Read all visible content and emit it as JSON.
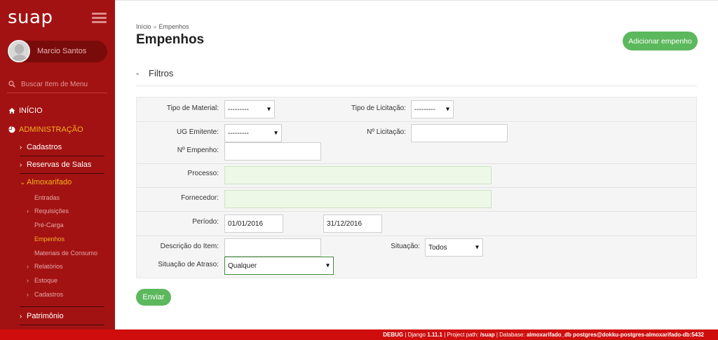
{
  "app": {
    "logo": "suap"
  },
  "user": {
    "name": "Marcio Santos"
  },
  "menu_search": {
    "placeholder": "Buscar Item de Menu"
  },
  "nav": {
    "inicio": "INÍCIO",
    "administracao": "ADMINISTRAÇÃO",
    "cadastros": "Cadastros",
    "reservas": "Reservas de Salas",
    "almoxarifado": "Almoxarifado",
    "sub": {
      "entradas": "Entradas",
      "requisicoes": "Requisições",
      "pre_carga": "Pré-Carga",
      "empenhos": "Empenhos",
      "materiais": "Materiais de Consumo",
      "relatorios": "Relatórios",
      "estoque": "Estoque",
      "cadastros": "Cadastros"
    },
    "patrimonio": "Patrimônio"
  },
  "breadcrumb": {
    "home": "Início",
    "sep": "»",
    "current": "Empenhos"
  },
  "page": {
    "title": "Empenhos",
    "add_button": "Adicionar empenho"
  },
  "filters": {
    "dash": "-",
    "title": "Filtros",
    "tipo_material": {
      "label": "Tipo de Material:",
      "value": "---------"
    },
    "tipo_licitacao": {
      "label": "Tipo de Licitação:",
      "value": "---------"
    },
    "ug_emitente": {
      "label": "UG Emitente:",
      "value": "---------"
    },
    "num_licitacao": {
      "label": "Nº Licitação:",
      "value": ""
    },
    "num_empenho": {
      "label": "Nº Empenho:",
      "value": ""
    },
    "processo": {
      "label": "Processo:",
      "value": ""
    },
    "fornecedor": {
      "label": "Fornecedor:",
      "value": ""
    },
    "periodo": {
      "label": "Período:",
      "start": "01/01/2016",
      "end": "31/12/2016"
    },
    "descricao_item": {
      "label": "Descrição do Item:",
      "value": ""
    },
    "situacao": {
      "label": "Situação:",
      "value": "Todos"
    },
    "situacao_atraso": {
      "label": "Situação de Atraso:",
      "value": "Qualquer"
    },
    "submit": "Enviar"
  },
  "footer": {
    "debug": "DEBUG",
    "django_prefix": " | Django ",
    "django_version": "1.11.1",
    "path_prefix": " | Project path: ",
    "path": "/suap",
    "db_prefix": " | Database: ",
    "db": "almoxarifado_db postgres@dokku-postgres-almoxarifado-db:5432"
  },
  "colors": {
    "sidebar": "#a31212",
    "accent": "#f3b31b",
    "button": "#5cb85c",
    "footer": "#cf0d0d"
  }
}
